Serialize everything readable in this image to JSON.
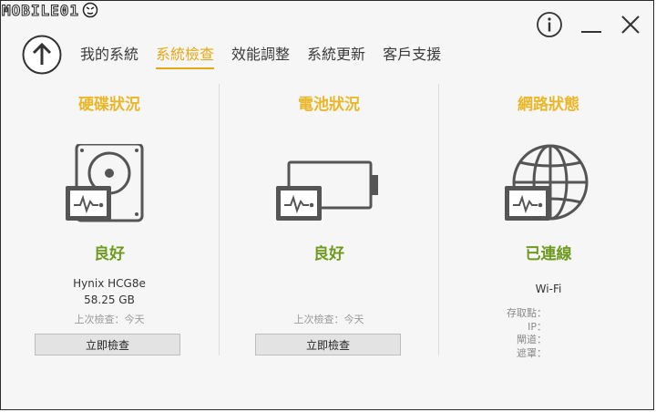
{
  "watermark": {
    "text": "MOBILE01"
  },
  "window": {
    "info_icon": "info-icon",
    "minimize_icon": "minimize-icon",
    "close_icon": "close-icon",
    "back_icon": "arrow-up-icon"
  },
  "tabs": [
    {
      "label": "我的系統",
      "active": false
    },
    {
      "label": "系統檢查",
      "active": true
    },
    {
      "label": "效能調整",
      "active": false
    },
    {
      "label": "系統更新",
      "active": false
    },
    {
      "label": "客戶支援",
      "active": false
    }
  ],
  "colors": {
    "accent": "#e6a817",
    "title": "#eab72a",
    "status_ok": "#6e9a1f",
    "icon": "#555555"
  },
  "disk": {
    "title": "硬碟狀況",
    "icon": "hard-drive-icon",
    "status": "良好",
    "model": "Hynix HCG8e",
    "capacity": "58.25 GB",
    "last_check": "上次檢查：今天",
    "button": "立即檢查"
  },
  "battery": {
    "title": "電池狀況",
    "icon": "battery-icon",
    "status": "良好",
    "last_check": "上次檢查：今天",
    "button": "立即檢查"
  },
  "network": {
    "title": "網路狀態",
    "icon": "globe-icon",
    "status": "已連線",
    "type": "Wi-Fi",
    "fields": [
      "存取點：",
      "IP：",
      "閘道：",
      "遮罩："
    ]
  }
}
